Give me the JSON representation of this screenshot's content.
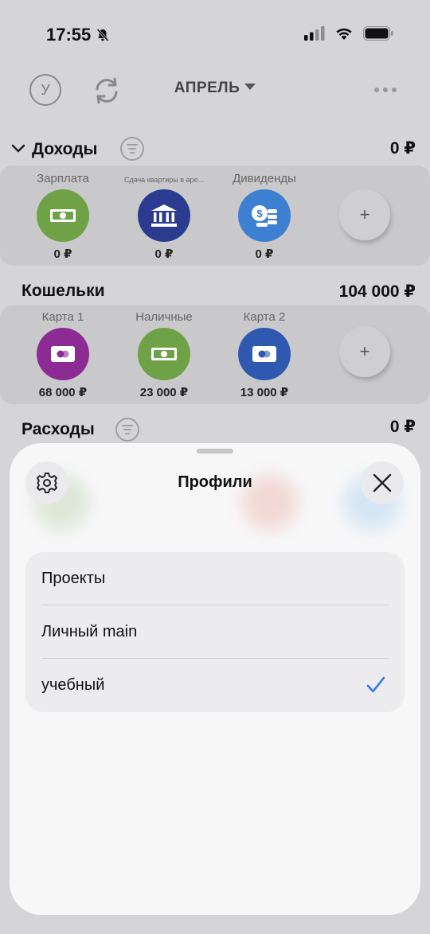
{
  "status_bar": {
    "time": "17:55"
  },
  "top_bar": {
    "avatar_letter": "У",
    "month": "АПРЕЛЬ"
  },
  "income": {
    "title": "Доходы",
    "total": "0 ₽",
    "items": [
      {
        "label": "Зарплата",
        "amount": "0 ₽",
        "icon": "cash-icon",
        "color": "#6fa247"
      },
      {
        "label": "Сдача квартиры в аре...",
        "amount": "0 ₽",
        "icon": "bank-icon",
        "color": "#2b3b8f"
      },
      {
        "label": "Дивиденды",
        "amount": "0 ₽",
        "icon": "coins-icon",
        "color": "#3d7fd0"
      }
    ],
    "add_label": "+"
  },
  "wallets": {
    "title": "Кошельки",
    "total": "104 000 ₽",
    "items": [
      {
        "label": "Карта 1",
        "amount": "68 000 ₽",
        "icon": "card-icon",
        "color": "#8b2b93"
      },
      {
        "label": "Наличные",
        "amount": "23 000 ₽",
        "icon": "cash-icon",
        "color": "#6fa247"
      },
      {
        "label": "Карта 2",
        "amount": "13 000 ₽",
        "icon": "card-icon",
        "color": "#2f59b0"
      }
    ],
    "add_label": "+"
  },
  "expenses": {
    "title": "Расходы",
    "total": "0 ₽"
  },
  "profiles_sheet": {
    "title": "Профили",
    "profiles": [
      {
        "name": "Проекты",
        "selected": false
      },
      {
        "name": "Личный main",
        "selected": false
      },
      {
        "name": "учебный",
        "selected": true
      }
    ],
    "accent_color": "#3478f6"
  }
}
